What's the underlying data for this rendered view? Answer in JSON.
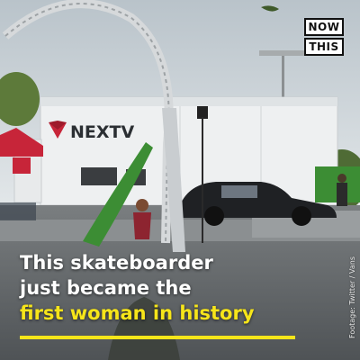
{
  "badge": {
    "line1": "NOW",
    "line2": "THIS"
  },
  "truck_logo": "NEXTV",
  "caption": {
    "line1": "This skateboarder",
    "line2": "just became the",
    "line3": "first woman in history"
  },
  "credit": "Footage: Twitter / Vans",
  "colors": {
    "highlight": "#f6e51a",
    "truck_red": "#c72539",
    "ramp_green": "#3c8d34",
    "sky": "#cfd7dc"
  }
}
